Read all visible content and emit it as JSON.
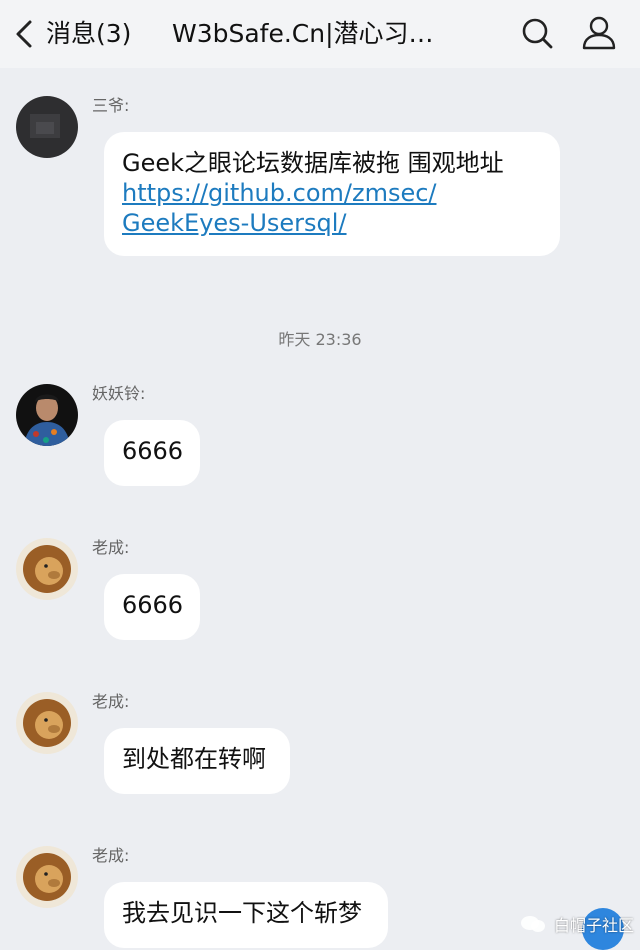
{
  "header": {
    "back_label": "消息(3)",
    "title": "W3bSafe.Cn|潜心习…"
  },
  "time_divider": "昨天 23:36",
  "messages": [
    {
      "sender": "三爷:",
      "text": "Geek之眼论坛数据库被拖 围观地址",
      "link_line1": "https://github.com/zmsec/",
      "link_line2": "GeekEyes-Usersql/"
    },
    {
      "sender": "妖妖铃:",
      "text": "6666"
    },
    {
      "sender": "老成:",
      "text": "6666"
    },
    {
      "sender": "老成:",
      "text": "到处都在转啊"
    },
    {
      "sender": "老成:",
      "text": "我去见识一下这个斩梦"
    }
  ],
  "watermark": "白帽子社区"
}
